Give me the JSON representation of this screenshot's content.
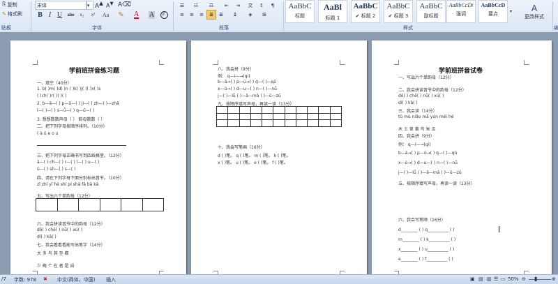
{
  "ribbon": {
    "clipboard": {
      "copy_label": "复制",
      "format_painter_label": "格式刷",
      "group_label": "贴板"
    },
    "font": {
      "font_name": "宋体",
      "font_size": "",
      "buttons": [
        "B",
        "I",
        "U",
        "abe",
        "x₂",
        "x²",
        "Aa"
      ],
      "group_label": "字体"
    },
    "paragraph": {
      "group_label": "段落"
    },
    "styles": {
      "cards": [
        {
          "sample": "AaBbC",
          "name": "标题"
        },
        {
          "sample": "AaBl",
          "name": "标题 1"
        },
        {
          "sample": "AaBbC",
          "name": "标题 2"
        },
        {
          "sample": "AaBbC",
          "name": "标题 3"
        },
        {
          "sample": "AaBbC",
          "name": "副标题"
        },
        {
          "sample": "AaBbCcDt",
          "name": "强调"
        },
        {
          "sample": "AaBbCcD",
          "name": "要点"
        }
      ],
      "change_styles_label": "更改样式",
      "group_label": "样式"
    },
    "edit_group_label": "编"
  },
  "page1": {
    "title": "学前班拼音练习题",
    "lines": [
      "一、填空（40分）",
      "1. b(    )m(    )d(    )n  (   )k(    )j(    )(    )x(    )s",
      "   (    )ch(    )r(    )(    )(    )",
      "2. b—ā—(       )   p—ǔ—(       )     ji—(       )     zh—(       )—zhǎ",
      "   l—(       )—(       )         s—ǖ—(       )     q—ū—(       )",
      "3. 想想数数声母（    ）   韵母数数（    ）",
      "二、把下列字母按顺序排列。（10分）",
      "      (    à    ü    e    o    u",
      "三、把下列字母正确书写到四线格里。（12分）",
      "ā—(       )    ch—(       )    r—(       )    l—(       )    u—(       )",
      "ü—(       )    sh—(       )    s—(       )",
      "四、请在下列字母下面分别标出音节。（10分）",
      "zǐ    zhī    yī    hé    shí    pí    shā    fǎ    bā    kā",
      "五、写出六个单韵母（12分）",
      "六、我会拼读音节中的韵母（12分）",
      "dǒ(        )     chě(        )     nǚ(        )     xú(        )",
      "dí(        )     kǎ(        )",
      "七、我会看看看能写出笔字（14分）",
      "大      多      鸟      其      至      都",
      "少      梅      个      在      者      是      自"
    ]
  },
  "page2": {
    "lines": [
      "八、我会拼（9分）",
      "例：  q—i—→(qi)",
      "b—ā→(    )   p—ū→(    )   q—(    )—qū",
      "x—ū→(    )   d—u—(    )   n—(    )—nǚ",
      "j—(    )—lǚ   (    )—ā—mā   (    )—ū—zū",
      "九、按顺序填写声母，再读一读（13分）",
      "十、我会写笔画（16分）",
      "d  (    )笔。  q (    )笔。     m (    )笔。  k (    )笔。",
      "x  (    )笔。  u (    )笔。     e (    )笔。  f (    )笔。"
    ]
  },
  "page3": {
    "title": "学前班拼音试卷",
    "lines": [
      "一、写出六个单韵母（12分）",
      "二、我会拼读音节中的韵母（12分）",
      "dǒ(         )     chě(         )     nǚ(         )     xú(         )",
      "dí(         )     kǎ(         )",
      "三、我会读（14分）",
      "tǔ      mù     niǎo mǎ    yún      méi      hé",
      "木      土      草      黄      鸟      米      瓜",
      "四、我会拼（9分）",
      "例：  q—i—→(qi)",
      "b—ā→(         )     p—ū→(         )     q—(    )—qū",
      "x—ū→(         )     d—u—(         )     n—(    )—nǚ",
      "j—(    )—lǚ        (    )—ā—mā         (    )—ū—zū",
      "五、按顺序填写声母，再读一读（13分）",
      "六、我会写笔顺（16分）",
      "d________  (      )    q__________  (      )",
      "m________  (      )    k__________  (      )",
      "x________  (      )    u__________  (      )",
      "e________  (      )    f__________  (      )"
    ]
  },
  "status": {
    "page": "/7",
    "wordcount": "字数: 978",
    "language": "中文(简体，中国)",
    "mode": "插入",
    "zoom": "50%"
  }
}
